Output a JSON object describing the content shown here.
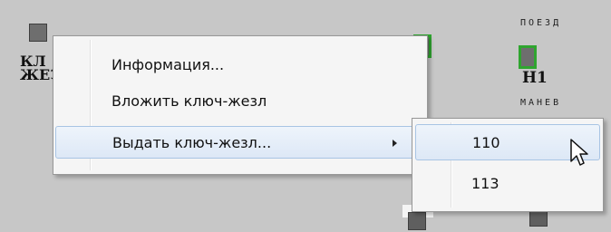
{
  "scheme": {
    "left_label_line1": "КЛ",
    "left_label_line2": "ЖЕЗ",
    "signal_label": "Н1",
    "header_top": "ПОЕЗД",
    "header_mid": "МАНЕВ",
    "colors": {
      "signal_ok": "#2fa52f",
      "menu_highlight": "#dde8f6"
    }
  },
  "context_menu": {
    "items": [
      {
        "label": "Информация..."
      },
      {
        "label": "Вложить ключ-жезл"
      },
      {
        "label": "Выдать ключ-жезл...",
        "has_submenu": true,
        "highlighted": true
      }
    ]
  },
  "submenu": {
    "items": [
      {
        "label": "110",
        "highlighted": true
      },
      {
        "label": "113"
      }
    ]
  },
  "icons": {
    "submenu_arrow": "chevron-right-icon",
    "pointer": "mouse-cursor-icon"
  }
}
